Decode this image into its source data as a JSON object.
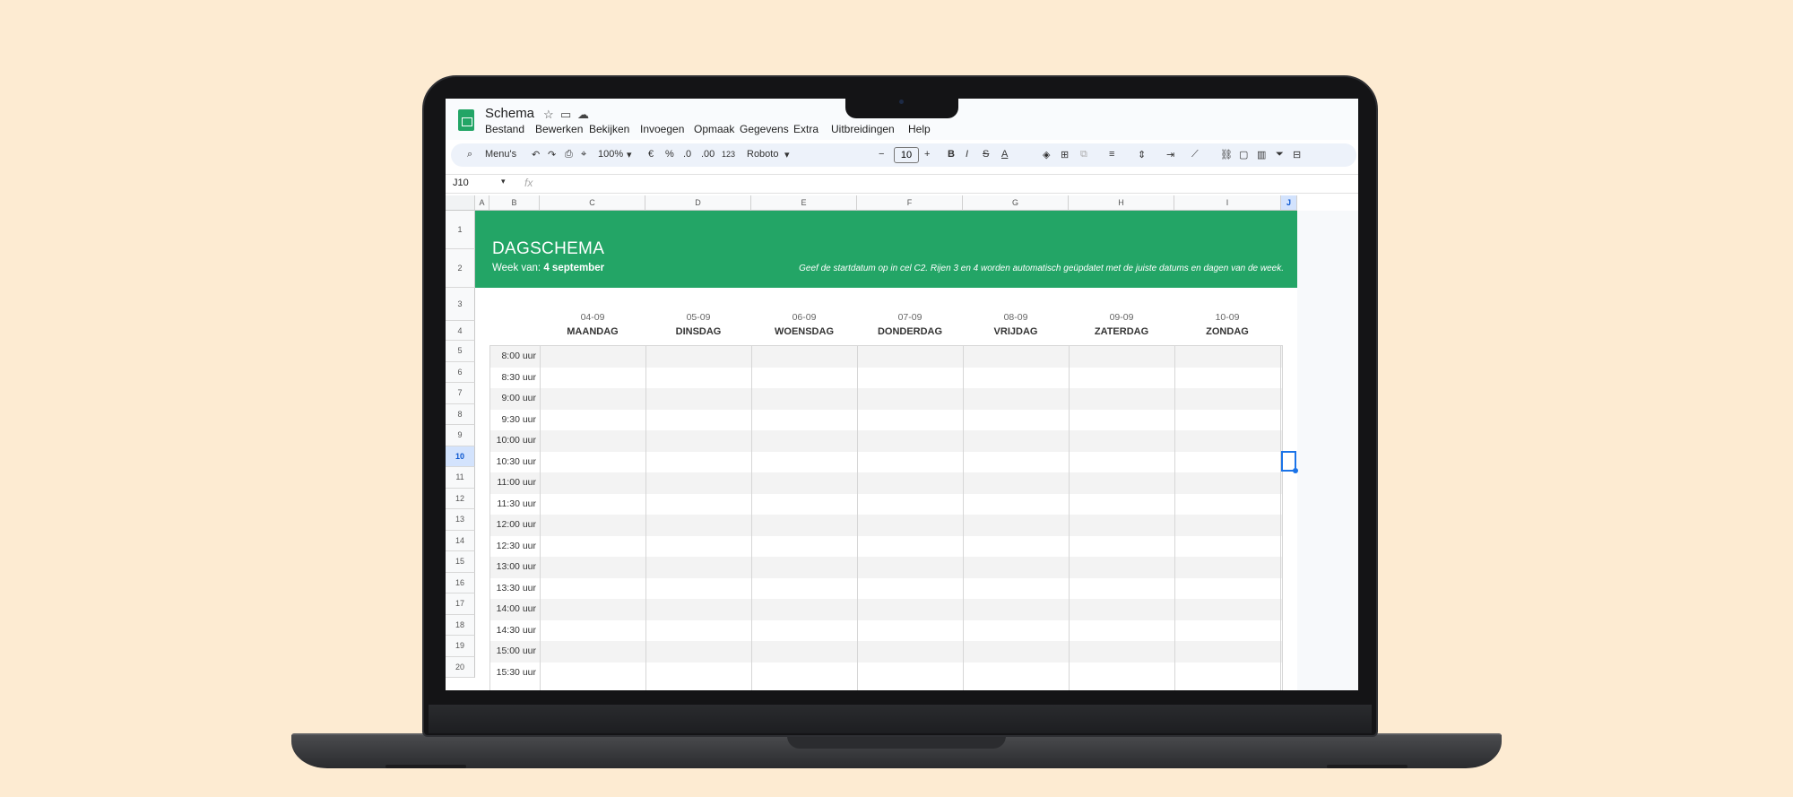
{
  "app": {
    "doc_title": "Schema",
    "menu": [
      "Bestand",
      "Bewerken",
      "Bekijken",
      "Invoegen",
      "Opmaak",
      "Gegevens",
      "Extra",
      "Uitbreidingen",
      "Help"
    ]
  },
  "toolbar": {
    "search_label": "Menu's",
    "zoom": "100%",
    "currency": "€",
    "percent": "%",
    "decimal_decrease": ".0",
    "decimal_increase": ".00",
    "number_format": "123",
    "font": "Roboto",
    "font_size": "10",
    "bold": "B",
    "italic": "I",
    "strike": "S",
    "text_color": "A"
  },
  "formula_bar": {
    "cell_ref": "J10",
    "fx": "fx"
  },
  "columns": [
    "A",
    "B",
    "C",
    "D",
    "E",
    "F",
    "G",
    "H",
    "I",
    "J"
  ],
  "selected_column": "J",
  "rows": [
    "1",
    "2",
    "3",
    "4",
    "5",
    "6",
    "7",
    "8",
    "9",
    "10",
    "11",
    "12",
    "13",
    "14",
    "15",
    "16",
    "17",
    "18",
    "19",
    "20"
  ],
  "selected_row": "10",
  "schedule": {
    "title": "DAGSCHEMA",
    "week_label": "Week van:",
    "week_value": "4 september",
    "note": "Geef de startdatum op in cel C2. Rijen 3 en 4 worden automatisch geüpdatet met de juiste datums en dagen van de week.",
    "days": [
      {
        "date": "04-09",
        "name": "MAANDAG"
      },
      {
        "date": "05-09",
        "name": "DINSDAG"
      },
      {
        "date": "06-09",
        "name": "WOENSDAG"
      },
      {
        "date": "07-09",
        "name": "DONDERDAG"
      },
      {
        "date": "08-09",
        "name": "VRIJDAG"
      },
      {
        "date": "09-09",
        "name": "ZATERDAG"
      },
      {
        "date": "10-09",
        "name": "ZONDAG"
      }
    ],
    "times": [
      "8:00 uur",
      "8:30 uur",
      "9:00 uur",
      "9:30 uur",
      "10:00 uur",
      "10:30 uur",
      "11:00 uur",
      "11:30 uur",
      "12:00 uur",
      "12:30 uur",
      "13:00 uur",
      "13:30 uur",
      "14:00 uur",
      "14:30 uur",
      "15:00 uur",
      "15:30 uur"
    ]
  },
  "colors": {
    "brand_green": "#23a566",
    "selection_blue": "#1a73e8",
    "background": "#fdebd2"
  }
}
